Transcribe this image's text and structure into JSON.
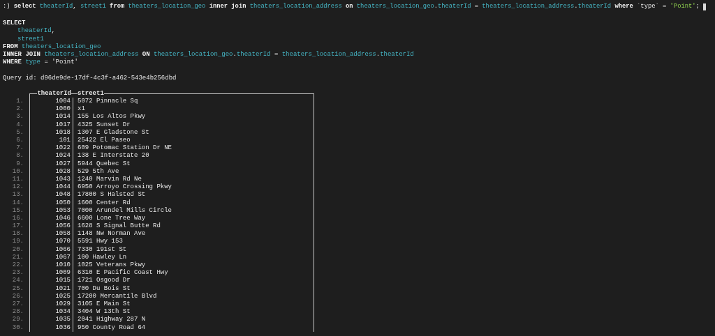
{
  "command": {
    "prompt": ":) ",
    "tokens": [
      {
        "text": "select ",
        "kind": "keyword"
      },
      {
        "text": "theaterId",
        "kind": "ident"
      },
      {
        "text": ", ",
        "kind": "plain"
      },
      {
        "text": "street1",
        "kind": "ident"
      },
      {
        "text": " from ",
        "kind": "keyword"
      },
      {
        "text": "theaters_location_geo",
        "kind": "ident"
      },
      {
        "text": " inner join ",
        "kind": "keyword"
      },
      {
        "text": "theaters_location_address",
        "kind": "ident"
      },
      {
        "text": " on ",
        "kind": "keyword"
      },
      {
        "text": "theaters_location_geo",
        "kind": "ident"
      },
      {
        "text": ".",
        "kind": "plain"
      },
      {
        "text": "theaterId",
        "kind": "ident"
      },
      {
        "text": " = ",
        "kind": "plain"
      },
      {
        "text": "theaters_location_address",
        "kind": "ident"
      },
      {
        "text": ".",
        "kind": "plain"
      },
      {
        "text": "theaterId",
        "kind": "ident"
      },
      {
        "text": " where ",
        "kind": "keyword"
      },
      {
        "text": "`type` = ",
        "kind": "plain"
      },
      {
        "text": "'Point'",
        "kind": "string"
      },
      {
        "text": ";",
        "kind": "plain"
      }
    ]
  },
  "formatted_query": {
    "head": [
      [
        {
          "text": "SELECT",
          "kind": "keyword"
        }
      ]
    ],
    "columns": [
      [
        {
          "text": "theaterId",
          "kind": "ident"
        },
        {
          "text": ",",
          "kind": "plain"
        }
      ],
      [
        {
          "text": "street1",
          "kind": "ident"
        }
      ]
    ],
    "tail": [
      [
        {
          "text": "FROM ",
          "kind": "keyword"
        },
        {
          "text": "theaters_location_geo",
          "kind": "ident"
        }
      ],
      [
        {
          "text": "INNER JOIN ",
          "kind": "keyword"
        },
        {
          "text": "theaters_location_address",
          "kind": "ident"
        },
        {
          "text": " ON ",
          "kind": "keyword"
        },
        {
          "text": "theaters_location_geo",
          "kind": "ident"
        },
        {
          "text": ".",
          "kind": "plain"
        },
        {
          "text": "theaterId",
          "kind": "ident"
        },
        {
          "text": " = ",
          "kind": "plain"
        },
        {
          "text": "theaters_location_address",
          "kind": "ident"
        },
        {
          "text": ".",
          "kind": "plain"
        },
        {
          "text": "theaterId",
          "kind": "ident"
        }
      ],
      [
        {
          "text": "WHERE ",
          "kind": "keyword"
        },
        {
          "text": "type",
          "kind": "ident"
        },
        {
          "text": " = 'Point'",
          "kind": "plain"
        }
      ]
    ]
  },
  "query_id": "Query id: d96de9de-17df-4c3f-a462-543e4b256dbd",
  "table": {
    "columns": [
      "theaterId",
      "street1"
    ],
    "rows": [
      {
        "num": "1.",
        "cells": [
          "1004",
          "5072 Pinnacle Sq"
        ]
      },
      {
        "num": "2.",
        "cells": [
          "1000",
          "x1"
        ]
      },
      {
        "num": "3.",
        "cells": [
          "1014",
          "155 Los Altos Pkwy"
        ]
      },
      {
        "num": "4.",
        "cells": [
          "1017",
          "4325 Sunset Dr"
        ]
      },
      {
        "num": "5.",
        "cells": [
          "1018",
          "1307 E Gladstone St"
        ]
      },
      {
        "num": "6.",
        "cells": [
          "101",
          "25422 El Paseo"
        ]
      },
      {
        "num": "7.",
        "cells": [
          "1022",
          "609 Potomac Station Dr NE"
        ]
      },
      {
        "num": "8.",
        "cells": [
          "1024",
          "138 E Interstate 20"
        ]
      },
      {
        "num": "9.",
        "cells": [
          "1027",
          "5944 Quebec St"
        ]
      },
      {
        "num": "10.",
        "cells": [
          "1028",
          "529 5th Ave"
        ]
      },
      {
        "num": "11.",
        "cells": [
          "1043",
          "1240 Marvin Rd Ne"
        ]
      },
      {
        "num": "12.",
        "cells": [
          "1044",
          "6950 Arroyo Crossing Pkwy"
        ]
      },
      {
        "num": "13.",
        "cells": [
          "1048",
          "17800 S Halsted St"
        ]
      },
      {
        "num": "14.",
        "cells": [
          "1050",
          "1600 Center Rd"
        ]
      },
      {
        "num": "15.",
        "cells": [
          "1053",
          "7000 Arundel Mills Circle"
        ]
      },
      {
        "num": "16.",
        "cells": [
          "1046",
          "6600 Lone Tree Way"
        ]
      },
      {
        "num": "17.",
        "cells": [
          "1056",
          "1628 S Signal Butte Rd"
        ]
      },
      {
        "num": "18.",
        "cells": [
          "1058",
          "1148 Nw Norman Ave"
        ]
      },
      {
        "num": "19.",
        "cells": [
          "1070",
          "5591 Hwy 153"
        ]
      },
      {
        "num": "20.",
        "cells": [
          "1066",
          "7330 191st St"
        ]
      },
      {
        "num": "21.",
        "cells": [
          "1067",
          "100 Hawley Ln"
        ]
      },
      {
        "num": "22.",
        "cells": [
          "1010",
          "1025 Veterans Pkwy"
        ]
      },
      {
        "num": "23.",
        "cells": [
          "1009",
          "6310 E Pacific Coast Hwy"
        ]
      },
      {
        "num": "24.",
        "cells": [
          "1015",
          "1721 Osgood Dr"
        ]
      },
      {
        "num": "25.",
        "cells": [
          "1021",
          "700 Du Bois St"
        ]
      },
      {
        "num": "26.",
        "cells": [
          "1025",
          "17200 Mercantile Blvd"
        ]
      },
      {
        "num": "27.",
        "cells": [
          "1029",
          "3105 E Main St"
        ]
      },
      {
        "num": "28.",
        "cells": [
          "1034",
          "3404 W 13th St"
        ]
      },
      {
        "num": "29.",
        "cells": [
          "1035",
          "2041 Highway 287 N"
        ]
      },
      {
        "num": "30.",
        "cells": [
          "1036",
          "950 County Road 64"
        ]
      }
    ]
  }
}
